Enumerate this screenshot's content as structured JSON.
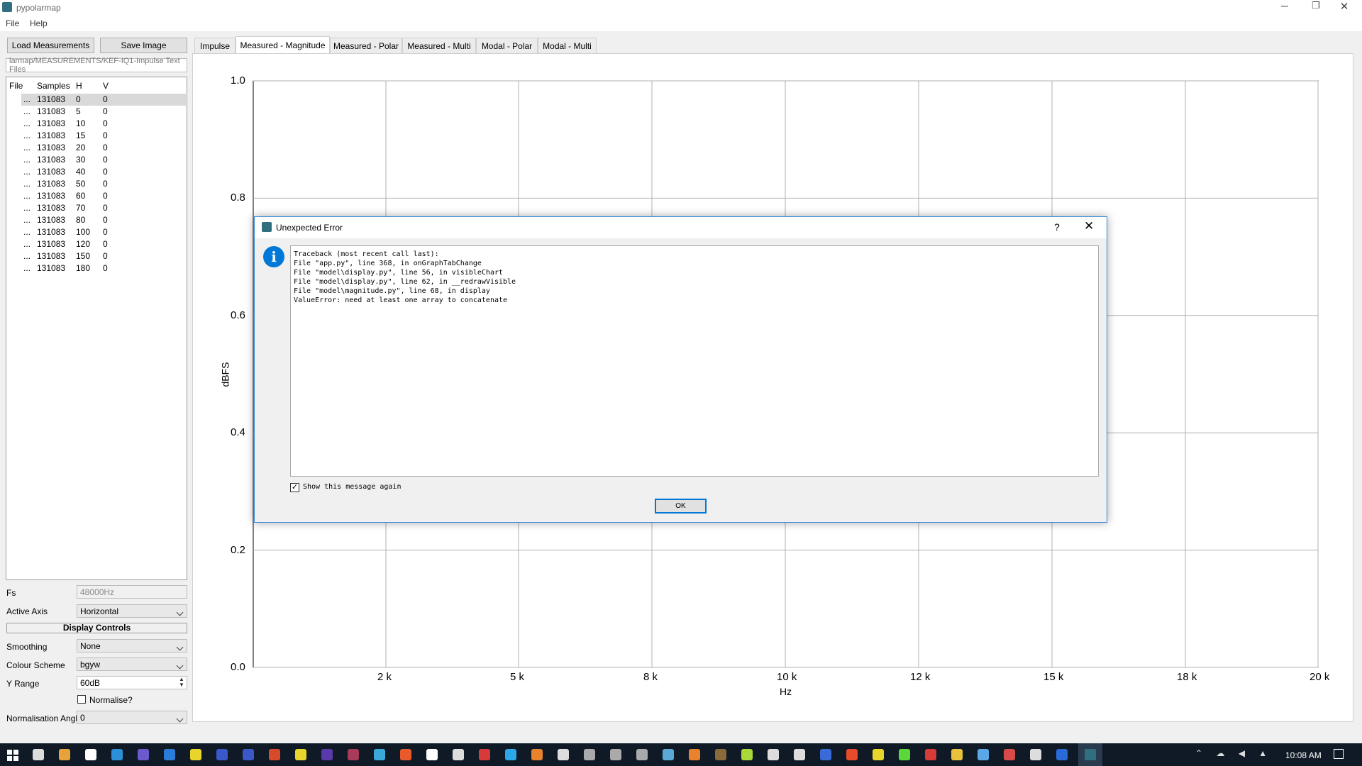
{
  "window": {
    "title": "pypolarmap"
  },
  "menu": [
    "File",
    "Help"
  ],
  "toolbar": {
    "load": "Load Measurements",
    "save": "Save Image"
  },
  "path": "larmap/MEASUREMENTS/KEF-IQ1-Impulse Text Files",
  "table": {
    "headers": [
      "File",
      "Samples",
      "H",
      "V"
    ],
    "rows": [
      [
        "...",
        "131083",
        "0",
        "0"
      ],
      [
        "...",
        "131083",
        "5",
        "0"
      ],
      [
        "...",
        "131083",
        "10",
        "0"
      ],
      [
        "...",
        "131083",
        "15",
        "0"
      ],
      [
        "...",
        "131083",
        "20",
        "0"
      ],
      [
        "...",
        "131083",
        "30",
        "0"
      ],
      [
        "...",
        "131083",
        "40",
        "0"
      ],
      [
        "...",
        "131083",
        "50",
        "0"
      ],
      [
        "...",
        "131083",
        "60",
        "0"
      ],
      [
        "...",
        "131083",
        "70",
        "0"
      ],
      [
        "...",
        "131083",
        "80",
        "0"
      ],
      [
        "...",
        "131083",
        "100",
        "0"
      ],
      [
        "...",
        "131083",
        "120",
        "0"
      ],
      [
        "...",
        "131083",
        "150",
        "0"
      ],
      [
        "...",
        "131083",
        "180",
        "0"
      ]
    ]
  },
  "controls": {
    "fs_label": "Fs",
    "fs_value": "48000Hz",
    "axis_label": "Active Axis",
    "axis_value": "Horizontal",
    "display_title": "Display Controls",
    "smoothing_label": "Smoothing",
    "smoothing_value": "None",
    "colour_label": "Colour Scheme",
    "colour_value": "bgyw",
    "yrange_label": "Y Range",
    "yrange_value": "60dB",
    "normalise_label": "Normalise?",
    "norm_angle_label": "Normalisation Angle",
    "norm_angle_value": "0"
  },
  "tabs": [
    "Impulse",
    "Measured - Magnitude",
    "Measured - Polar",
    "Measured - Multi",
    "Modal - Polar",
    "Modal - Multi"
  ],
  "active_tab": 1,
  "chart_data": {
    "type": "line",
    "xlabel": "Hz",
    "ylabel": "dBFS",
    "xticks": [
      "2 k",
      "5 k",
      "8 k",
      "10 k",
      "12 k",
      "15 k",
      "18 k",
      "20 k"
    ],
    "yticks": [
      "1.0",
      "0.8",
      "0.6",
      "0.4",
      "0.2",
      "0.0"
    ],
    "ylim": [
      0,
      1
    ],
    "grid": true,
    "series": []
  },
  "dialog": {
    "title": "Unexpected Error",
    "help": "?",
    "traceback": [
      "Traceback (most recent call last):",
      "File \"app.py\", line 368, in onGraphTabChange",
      "File \"model\\display.py\", line 56, in visibleChart",
      "File \"model\\display.py\", line 62, in __redrawVisible",
      "File \"model\\magnitude.py\", line 68, in display",
      "ValueError: need at least one array to concatenate"
    ],
    "checkbox_label": "Show this message again",
    "ok": "OK"
  },
  "taskbar": {
    "time": "10:08 AM"
  },
  "colors": {
    "accent": "#0078d7",
    "dialog_border": "#3a8ad8",
    "taskbar": "#0f1a26"
  }
}
